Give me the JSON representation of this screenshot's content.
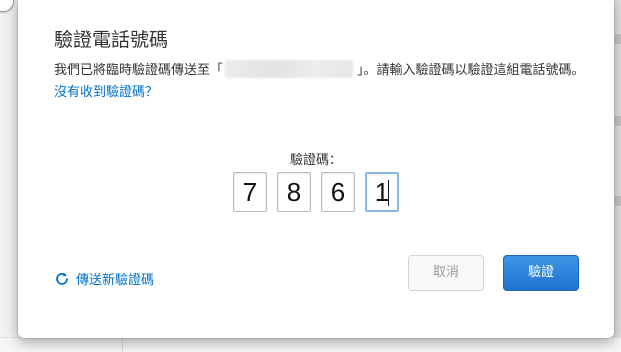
{
  "dialog": {
    "title": "驗證電話號碼",
    "description_before": "我們已將臨時驗證碼傳送至「",
    "description_after": "」。請輸入驗證碼以驗證這組電話號碼。",
    "no_code_link": "沒有收到驗證碼？",
    "code_label": "驗證碼：",
    "code_digits": [
      "7",
      "8",
      "6",
      "1"
    ],
    "resend_link": "傳送新驗證碼",
    "cancel_button": "取消",
    "verify_button": "驗證"
  },
  "icons": {
    "resend": "refresh-icon",
    "close": "close-circle-icon"
  },
  "colors": {
    "link": "#0070c9",
    "primary_button": "#1f73cf",
    "active_input_border": "#8fb7e6"
  }
}
